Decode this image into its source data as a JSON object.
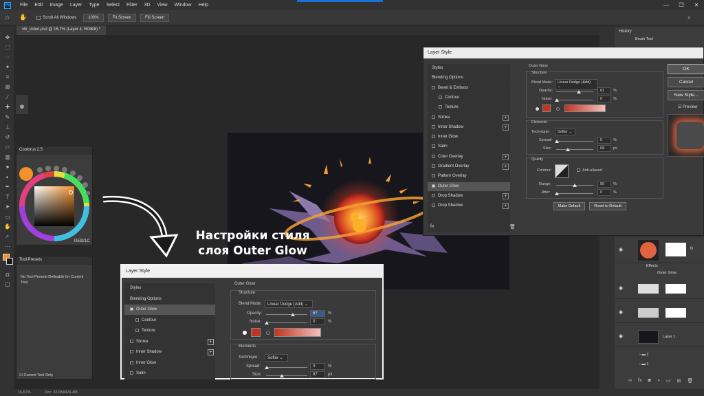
{
  "app": {
    "logo": "Ps",
    "menu": [
      "File",
      "Edit",
      "Image",
      "Layer",
      "Type",
      "Select",
      "Filter",
      "3D",
      "View",
      "Window",
      "Help"
    ],
    "window_controls": [
      "—",
      "❐",
      "✕"
    ]
  },
  "options": {
    "scroll_all": "Scroll All Windows",
    "zoom": "100%",
    "fit": "Fit Screen",
    "fill": "Fill Screen"
  },
  "doc": {
    "tab": "vfx_video.psd @ 16,7% (Layer 4, RGB/8) *"
  },
  "status": {
    "zoom": "16,67%",
    "doc": "Doc: 32,0M/424,4M"
  },
  "coolorus": {
    "title": "Coolorus 2.5",
    "hex": "DE921C"
  },
  "presets": {
    "title": "Tool Presets",
    "empty": "No Tool Presets Definable for Current Tool.",
    "current_only": "Current Tool Only"
  },
  "history": {
    "title": "History",
    "item": "Brush Tool"
  },
  "layers": {
    "effects": "Effects",
    "outer_glow": "Outer Glow",
    "layer1": "Layer 1",
    "g2": "2",
    "g1": "1"
  },
  "caption": {
    "line1": "Настройки стиля",
    "line2": "слоя Outer Glow"
  },
  "dlg1": {
    "title": "Layer Style",
    "styles": [
      {
        "label": "Styles"
      },
      {
        "label": "Blending Options"
      },
      {
        "label": "Bevel & Emboss",
        "cb": true
      },
      {
        "label": "Contour",
        "cb": true,
        "indent": true
      },
      {
        "label": "Texture",
        "cb": true,
        "indent": true
      },
      {
        "label": "Stroke",
        "cb": true,
        "plus": true
      },
      {
        "label": "Inner Shadow",
        "cb": true,
        "plus": true
      },
      {
        "label": "Inner Glow",
        "cb": true
      },
      {
        "label": "Satin",
        "cb": true
      },
      {
        "label": "Color Overlay",
        "cb": true,
        "plus": true
      },
      {
        "label": "Gradient Overlay",
        "cb": true,
        "plus": true
      },
      {
        "label": "Pattern Overlay",
        "cb": true
      },
      {
        "label": "Outer Glow",
        "cb": true,
        "checked": true,
        "active": true
      },
      {
        "label": "Drop Shadow",
        "cb": true,
        "plus": true
      },
      {
        "label": "Drop Shadow",
        "cb": true,
        "plus": true
      }
    ],
    "fx": "fx",
    "section": "Outer Glow",
    "structure": "Structure",
    "blend_label": "Blend Mode:",
    "blend_value": "Linear Dodge (Add)",
    "opacity_label": "Opacity:",
    "opacity": "61",
    "noise_label": "Noise:",
    "noise": "0",
    "pct": "%",
    "elements": "Elements",
    "technique_label": "Technique:",
    "technique": "Softer",
    "spread_label": "Spread:",
    "spread": "0",
    "size_label": "Size:",
    "size": "68",
    "px": "px",
    "quality": "Quality",
    "contour_label": "Contour:",
    "anti": "Anti-aliased",
    "range_label": "Range:",
    "range": "50",
    "jitter_label": "Jitter:",
    "jitter": "0",
    "make_default": "Make Default",
    "reset_default": "Reset to Default",
    "ok": "OK",
    "cancel": "Cancel",
    "new_style": "New Style...",
    "preview": "Preview"
  },
  "dlg2": {
    "title": "Layer Style",
    "styles": [
      {
        "label": "Styles"
      },
      {
        "label": "Blending Options"
      },
      {
        "label": "Outer Glow",
        "cb": true,
        "checked": true,
        "active": true
      },
      {
        "label": "Contour",
        "cb": true,
        "indent": true
      },
      {
        "label": "Texture",
        "cb": true,
        "indent": true
      },
      {
        "label": "Stroke",
        "cb": true,
        "plus": true
      },
      {
        "label": "Inner Shadow",
        "cb": true,
        "plus": true
      },
      {
        "label": "Inner Glow",
        "cb": true
      },
      {
        "label": "Satin",
        "cb": true
      }
    ],
    "section": "Outer Glow",
    "structure": "Structure",
    "blend_label": "Blend Mode:",
    "blend_value": "Linear Dodge (Add)",
    "opacity_label": "Opacity:",
    "opacity": "67",
    "noise_label": "Noise:",
    "noise": "0",
    "pct": "%",
    "elements": "Elements",
    "technique_label": "Technique:",
    "technique": "Softer",
    "spread_label": "Spread:",
    "spread": "0",
    "size_label": "Size:",
    "size": "87",
    "px": "px"
  },
  "colors": {
    "glow": "#c0361e",
    "accent": "#f2922c",
    "ps_blue": "#31a8ff"
  }
}
